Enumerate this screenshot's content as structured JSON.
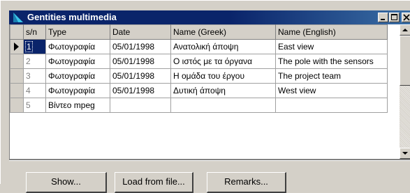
{
  "window": {
    "title": "Gentities multimedia",
    "controls": [
      "minimize",
      "maximize",
      "close"
    ]
  },
  "grid": {
    "columns": [
      "s/n",
      "Type",
      "Date",
      "Name (Greek)",
      "Name (English)"
    ],
    "rows": [
      {
        "sn": "1",
        "type": "Φωτογραφία",
        "date": "05/01/1998",
        "name_greek": "Ανατολική άποψη",
        "name_english": "East view",
        "current": true
      },
      {
        "sn": "2",
        "type": "Φωτογραφία",
        "date": "05/01/1998",
        "name_greek": "Ο ιστός με τα όργανα",
        "name_english": "The pole with the sensors",
        "current": false
      },
      {
        "sn": "3",
        "type": "Φωτογραφία",
        "date": "05/01/1998",
        "name_greek": "Η ομάδα του έργου",
        "name_english": "The project team",
        "current": false
      },
      {
        "sn": "4",
        "type": "Φωτογραφία",
        "date": "05/01/1998",
        "name_greek": "Δυτική άποψη",
        "name_english": "West view",
        "current": false
      },
      {
        "sn": "5",
        "type": "Βίντεο mpeg",
        "date": "",
        "name_greek": "",
        "name_english": "",
        "current": false
      }
    ]
  },
  "buttons": {
    "show": "Show...",
    "load": "Load from file...",
    "remarks": "Remarks..."
  },
  "colors": {
    "titlebar": "#0a246a",
    "face": "#d4d0c8",
    "selection": "#0a246a"
  }
}
